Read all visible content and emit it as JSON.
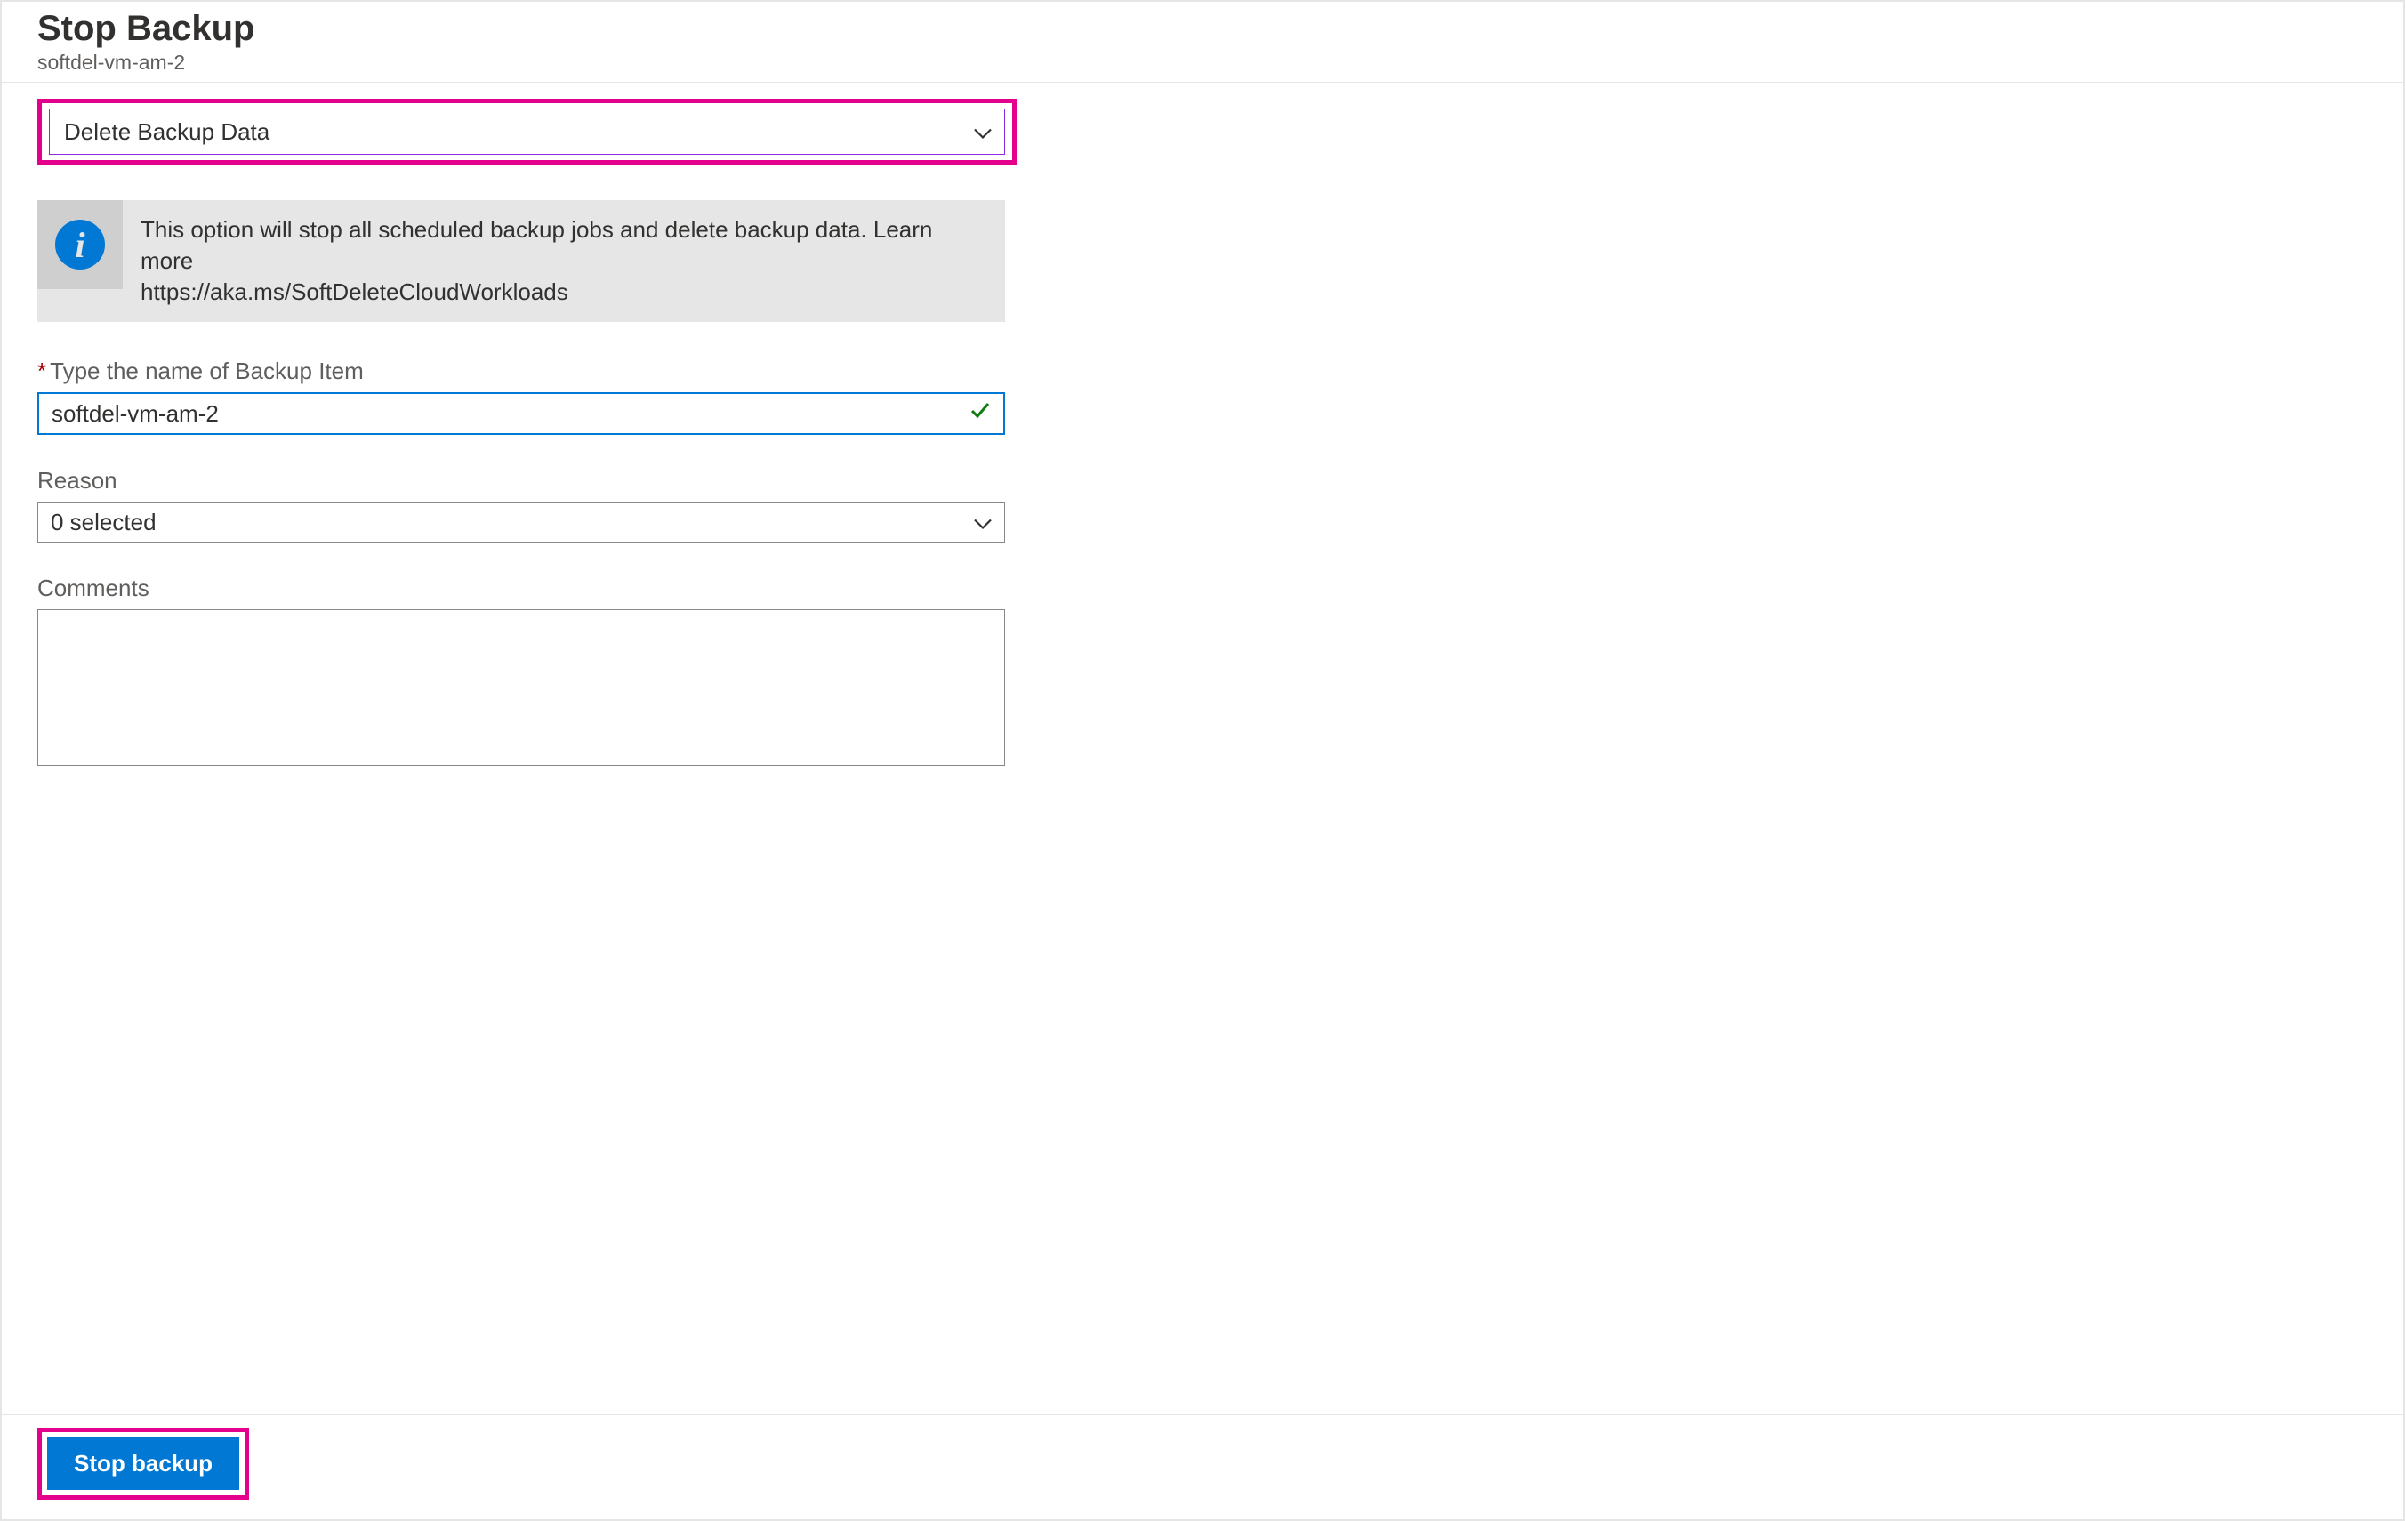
{
  "header": {
    "title": "Stop Backup",
    "subtitle": "softdel-vm-am-2"
  },
  "actionSelect": {
    "value": "Delete Backup Data"
  },
  "infoBox": {
    "text": "This option will stop all scheduled backup jobs and delete backup data. Learn more",
    "link": "https://aka.ms/SoftDeleteCloudWorkloads"
  },
  "fields": {
    "backupItem": {
      "label": "Type the name of Backup Item",
      "value": "softdel-vm-am-2"
    },
    "reason": {
      "label": "Reason",
      "value": "0 selected"
    },
    "comments": {
      "label": "Comments",
      "value": ""
    }
  },
  "footer": {
    "primary": "Stop backup"
  }
}
